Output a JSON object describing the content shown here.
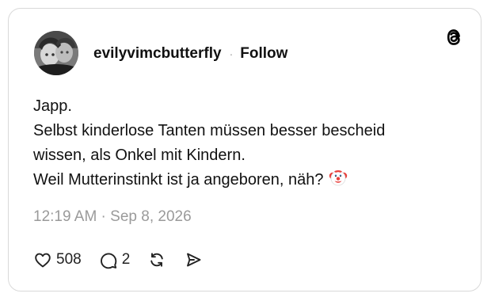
{
  "post": {
    "username": "evilyvimcbutterfly",
    "separator": "·",
    "follow_label": "Follow",
    "text_lines": [
      "Japp.",
      "Selbst kinderlose Tanten müssen besser bescheid",
      "wissen, als Onkel mit Kindern.",
      "Weil Mutterinstinkt ist ja angeboren, näh?"
    ],
    "emoji": "clown-face",
    "timestamp": "12:19 AM · Sep 8, 2026",
    "likes": "508",
    "replies": "2"
  },
  "icons": {
    "brand": "threads-logo-icon",
    "like": "heart-icon",
    "reply": "comment-icon",
    "repost": "repost-icon",
    "share": "send-icon"
  },
  "colors": {
    "text": "#111111",
    "muted": "#9a9a9a",
    "border": "#d9d9d9",
    "clown_red": "#e8413d"
  }
}
